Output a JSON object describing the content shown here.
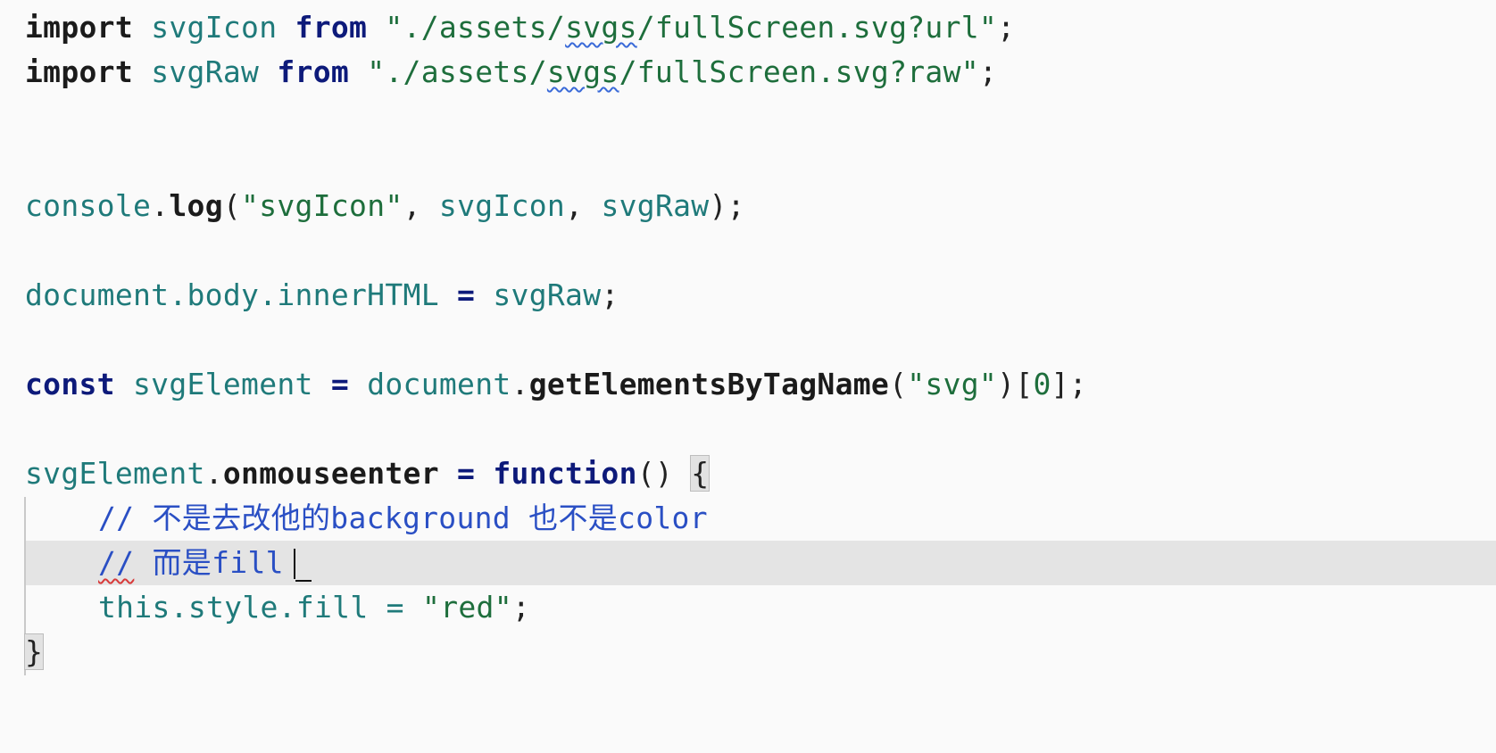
{
  "editor": {
    "lines": {
      "l1": {
        "import": "import",
        "name": "svgIcon",
        "from": "from",
        "path_prefix": "\"./assets/",
        "path_squiggle": "svgs",
        "path_suffix": "/fullScreen.svg?url\"",
        "semicolon": ";"
      },
      "l2": {
        "import": "import",
        "name": "svgRaw",
        "from": "from",
        "path_prefix": "\"./assets/",
        "path_squiggle": "svgs",
        "path_suffix": "/fullScreen.svg?raw\"",
        "semicolon": ";"
      },
      "l3": {
        "obj": "console",
        "dot": ".",
        "method": "log",
        "open": "(",
        "arg1": "\"svgIcon\"",
        "comma1": ", ",
        "arg2": "svgIcon",
        "comma2": ", ",
        "arg3": "svgRaw",
        "close": ");"
      },
      "l4": {
        "target": "document.body.innerHTML",
        "eq": " = ",
        "value": "svgRaw",
        "semicolon": ";"
      },
      "l5": {
        "const": "const",
        "name": "svgElement",
        "eq": " = ",
        "obj": "document",
        "dot": ".",
        "method": "getElementsByTagName",
        "open": "(",
        "arg": "\"svg\"",
        "close": ")",
        "index_open": "[",
        "index": "0",
        "index_close": "];"
      },
      "l6": {
        "obj": "svgElement",
        "dot": ".",
        "prop": "onmouseenter",
        "eq": " = ",
        "function": "function",
        "parens": "() ",
        "brace": "{"
      },
      "l7": {
        "comment": "// 不是去改他的background 也不是color"
      },
      "l8": {
        "comment_slashes": "//",
        "comment_text": " 而是fill"
      },
      "l9": {
        "code": "this.style.fill = ",
        "value": "\"red\"",
        "semicolon": ";"
      },
      "l10": {
        "brace": "}"
      }
    }
  },
  "colors": {
    "keyword": "#0d1a7a",
    "identifier": "#1f7a7a",
    "string": "#1e6e3c",
    "comment": "#2a4fc4",
    "current_line": "#e4e4e4",
    "background": "#fafafa"
  }
}
